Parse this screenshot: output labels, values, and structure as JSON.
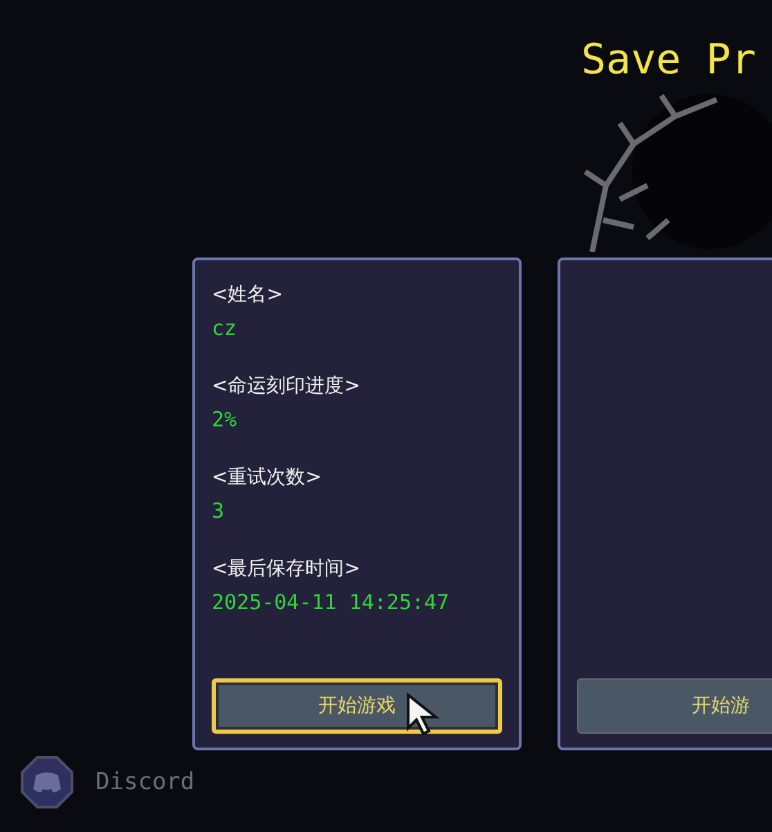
{
  "title": "Save Pr",
  "slots": [
    {
      "fields": [
        {
          "label": "<姓名>",
          "value": "cz"
        },
        {
          "label": "<命运刻印进度>",
          "value": "2%"
        },
        {
          "label": "<重试次数>",
          "value": "3"
        },
        {
          "label": "<最后保存时间>",
          "value": "2025-04-11 14:25:47"
        }
      ],
      "button": {
        "label": "开始游戏",
        "focused": true
      }
    },
    {
      "button": {
        "label": "开始游",
        "focused": false
      }
    }
  ],
  "discord": {
    "label": "Discord"
  }
}
